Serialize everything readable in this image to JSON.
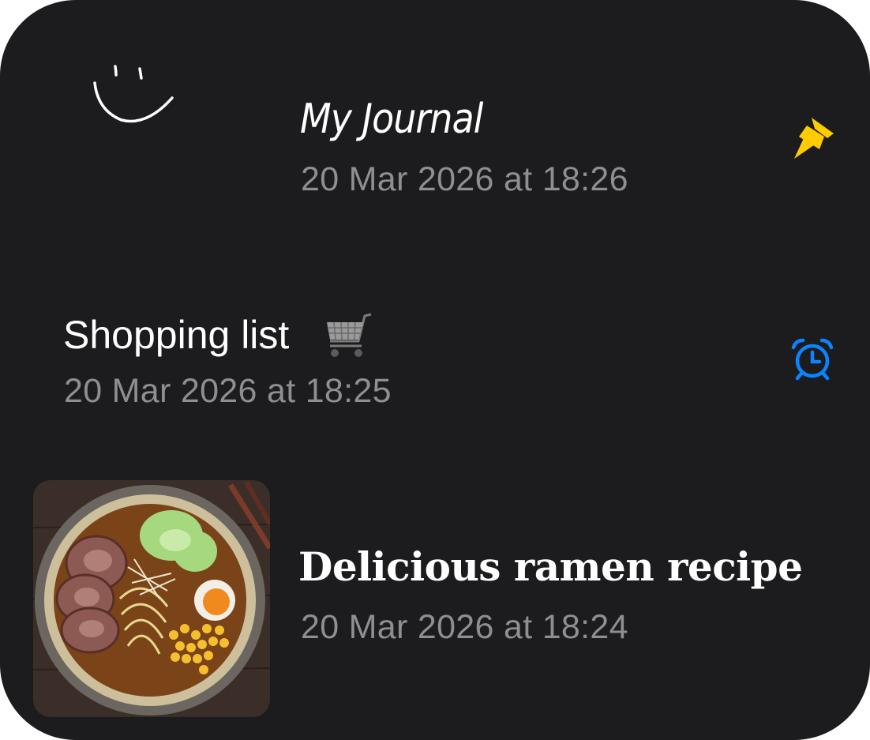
{
  "notes": [
    {
      "title": "My Journal",
      "date": "20 Mar 2026 at 18:26",
      "thumbnail": "smiley-doodle",
      "status_icon": "pin-icon",
      "status_color": "#ffcc00"
    },
    {
      "title": "Shopping list",
      "title_emoji": "shopping-cart-icon",
      "date": "20 Mar 2026 at 18:25",
      "status_icon": "alarm-clock-icon",
      "status_color": "#0a84ff"
    },
    {
      "title": "Delicious ramen recipe",
      "date": "20 Mar 2026 at 18:24",
      "thumbnail": "ramen-bowl-photo"
    }
  ],
  "colors": {
    "background": "#1c1c1e",
    "title_text": "#ffffff",
    "date_text": "#8e8e93"
  }
}
